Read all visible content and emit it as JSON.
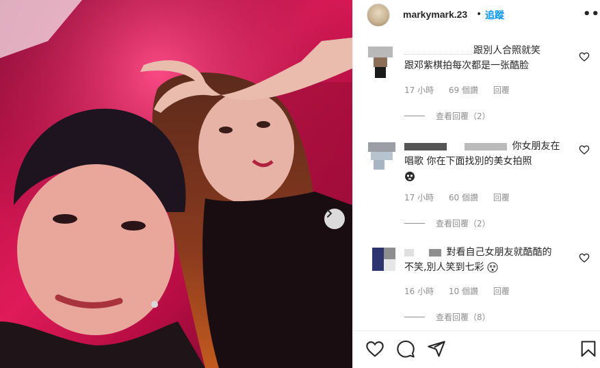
{
  "post": {
    "username": "markymark.23",
    "separator": "•",
    "follow_label": "追蹤",
    "more_label": "•••"
  },
  "comments": [
    {
      "lines": [
        "跟別人合照就笑",
        "跟邓紫棋拍每次都是一张酷脸"
      ],
      "time": "17 小時",
      "likes": "69 個讚",
      "reply_label": "回覆",
      "view_replies": "查看回覆（2）"
    },
    {
      "lines": [
        "你女朋友在",
        "唱歌 你在下面找別的美女拍照",
        ""
      ],
      "time": "17 小時",
      "likes": "60 個讚",
      "reply_label": "回覆",
      "view_replies": "查看回覆（2）"
    },
    {
      "lines": [
        "對看自己女朋友就酷酷的",
        "不笑,別人笑到七彩"
      ],
      "time": "16 小時",
      "likes": "10 個讚",
      "reply_label": "回覆",
      "view_replies": "查看回覆（8）"
    }
  ],
  "icons": {
    "like": "heart-icon",
    "comment": "comment-icon",
    "share": "share-icon",
    "save": "bookmark-icon",
    "next": "chevron-right-icon",
    "emoji_skull": "skull-emoji-icon",
    "emoji_dizzy": "dizzy-face-emoji-icon"
  }
}
